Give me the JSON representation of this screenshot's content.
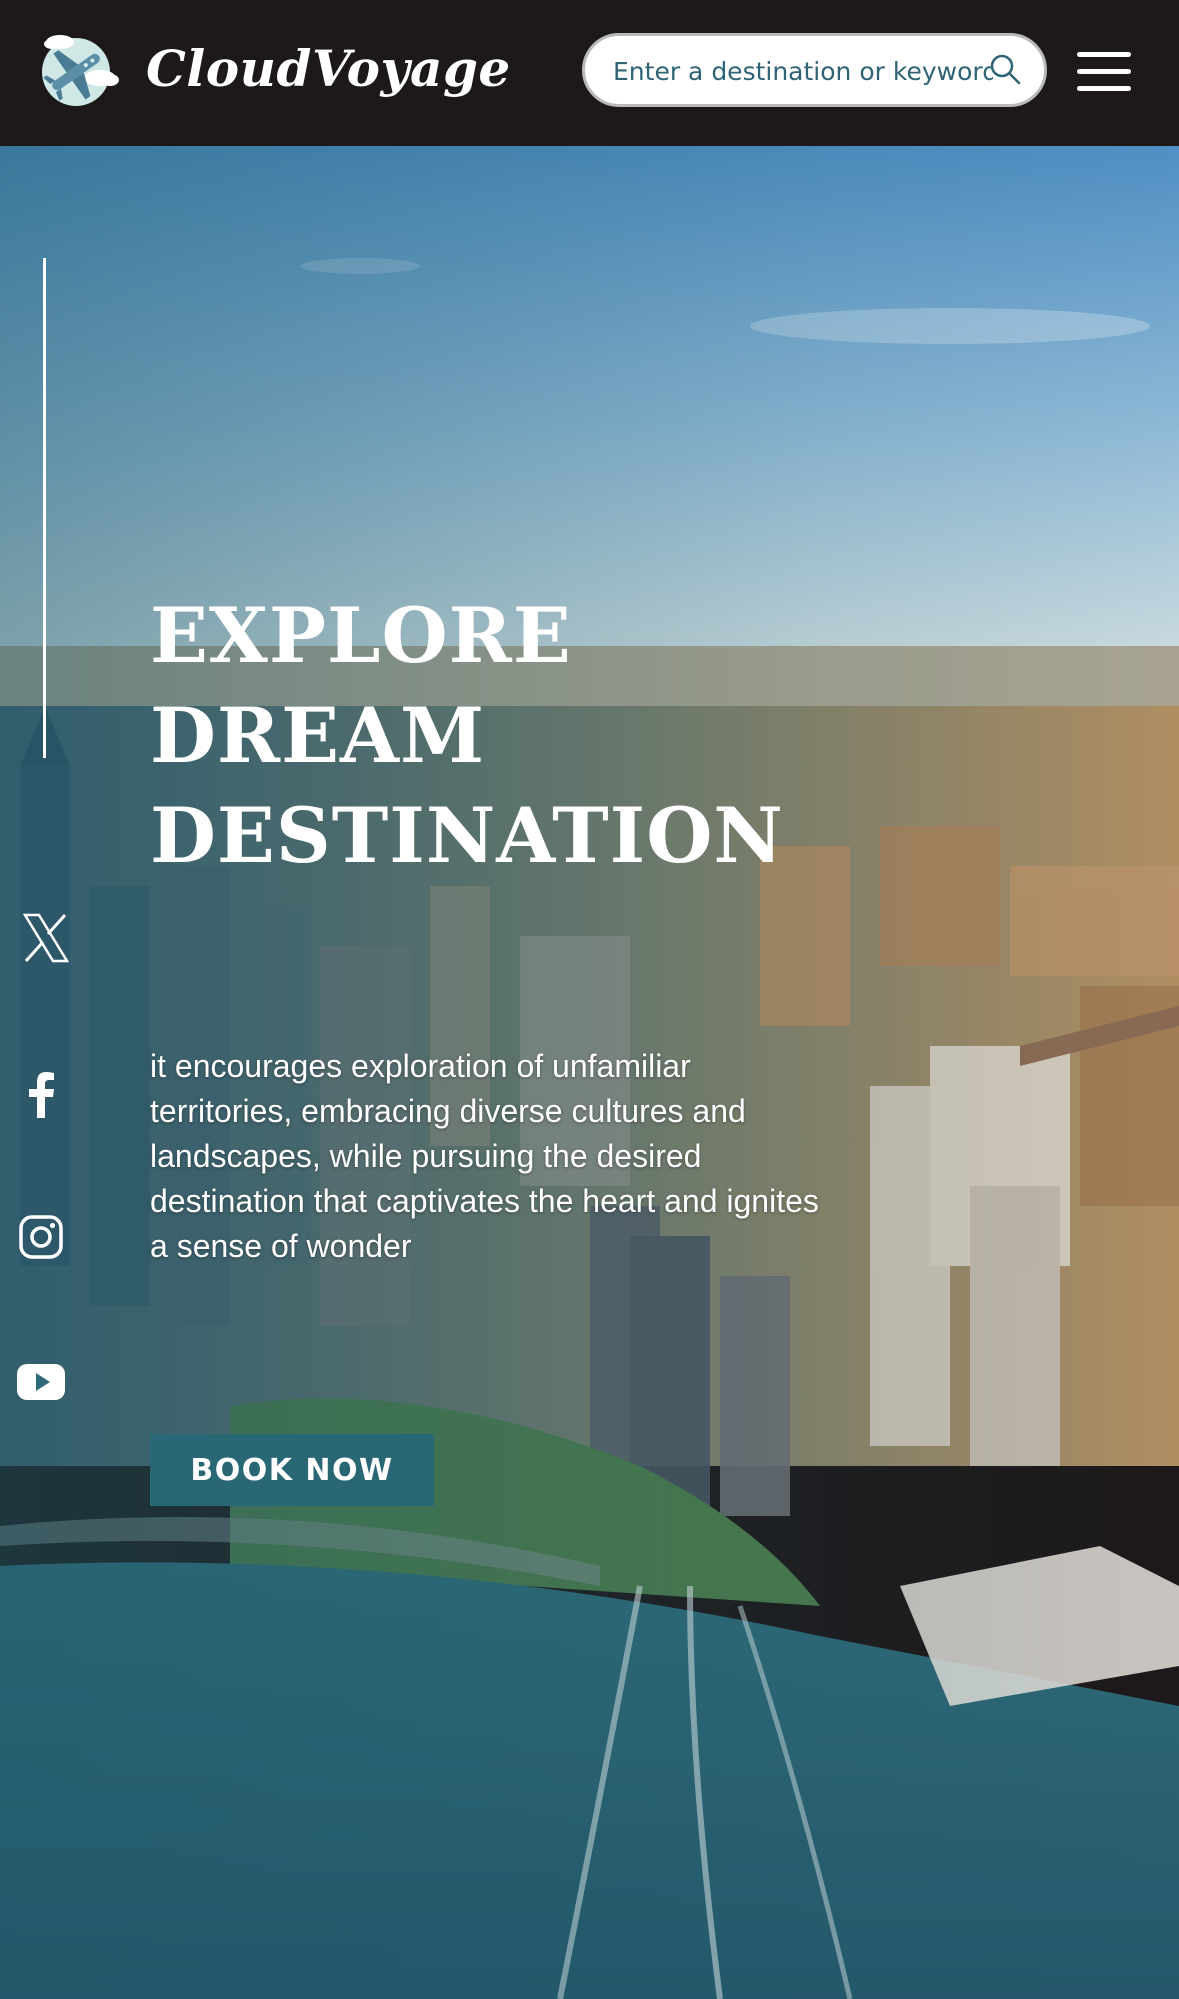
{
  "header": {
    "brand": "CloudVoyage",
    "logo_icon": "airplane-cloud-icon",
    "search": {
      "placeholder": "Enter a destination or keyword",
      "value": ""
    },
    "search_icon": "search-icon",
    "menu_icon": "hamburger-menu-icon"
  },
  "hero": {
    "headline": [
      "EXPLORE",
      "DREAM",
      "DESTINATION"
    ],
    "description": "it encourages exploration of unfamiliar territories, embracing diverse cultures and landscapes, while pursuing the desired destination that captivates the heart and ignites a sense of wonder",
    "cta_label": "BOOK NOW",
    "background": "aerial-city-skyline-image"
  },
  "social": [
    "x-icon",
    "facebook-icon",
    "instagram-icon",
    "youtube-icon"
  ],
  "colors": {
    "header_bg": "#1d1819",
    "accent": "#2a6775",
    "search_text": "#2e6475",
    "text": "#ffffff"
  }
}
